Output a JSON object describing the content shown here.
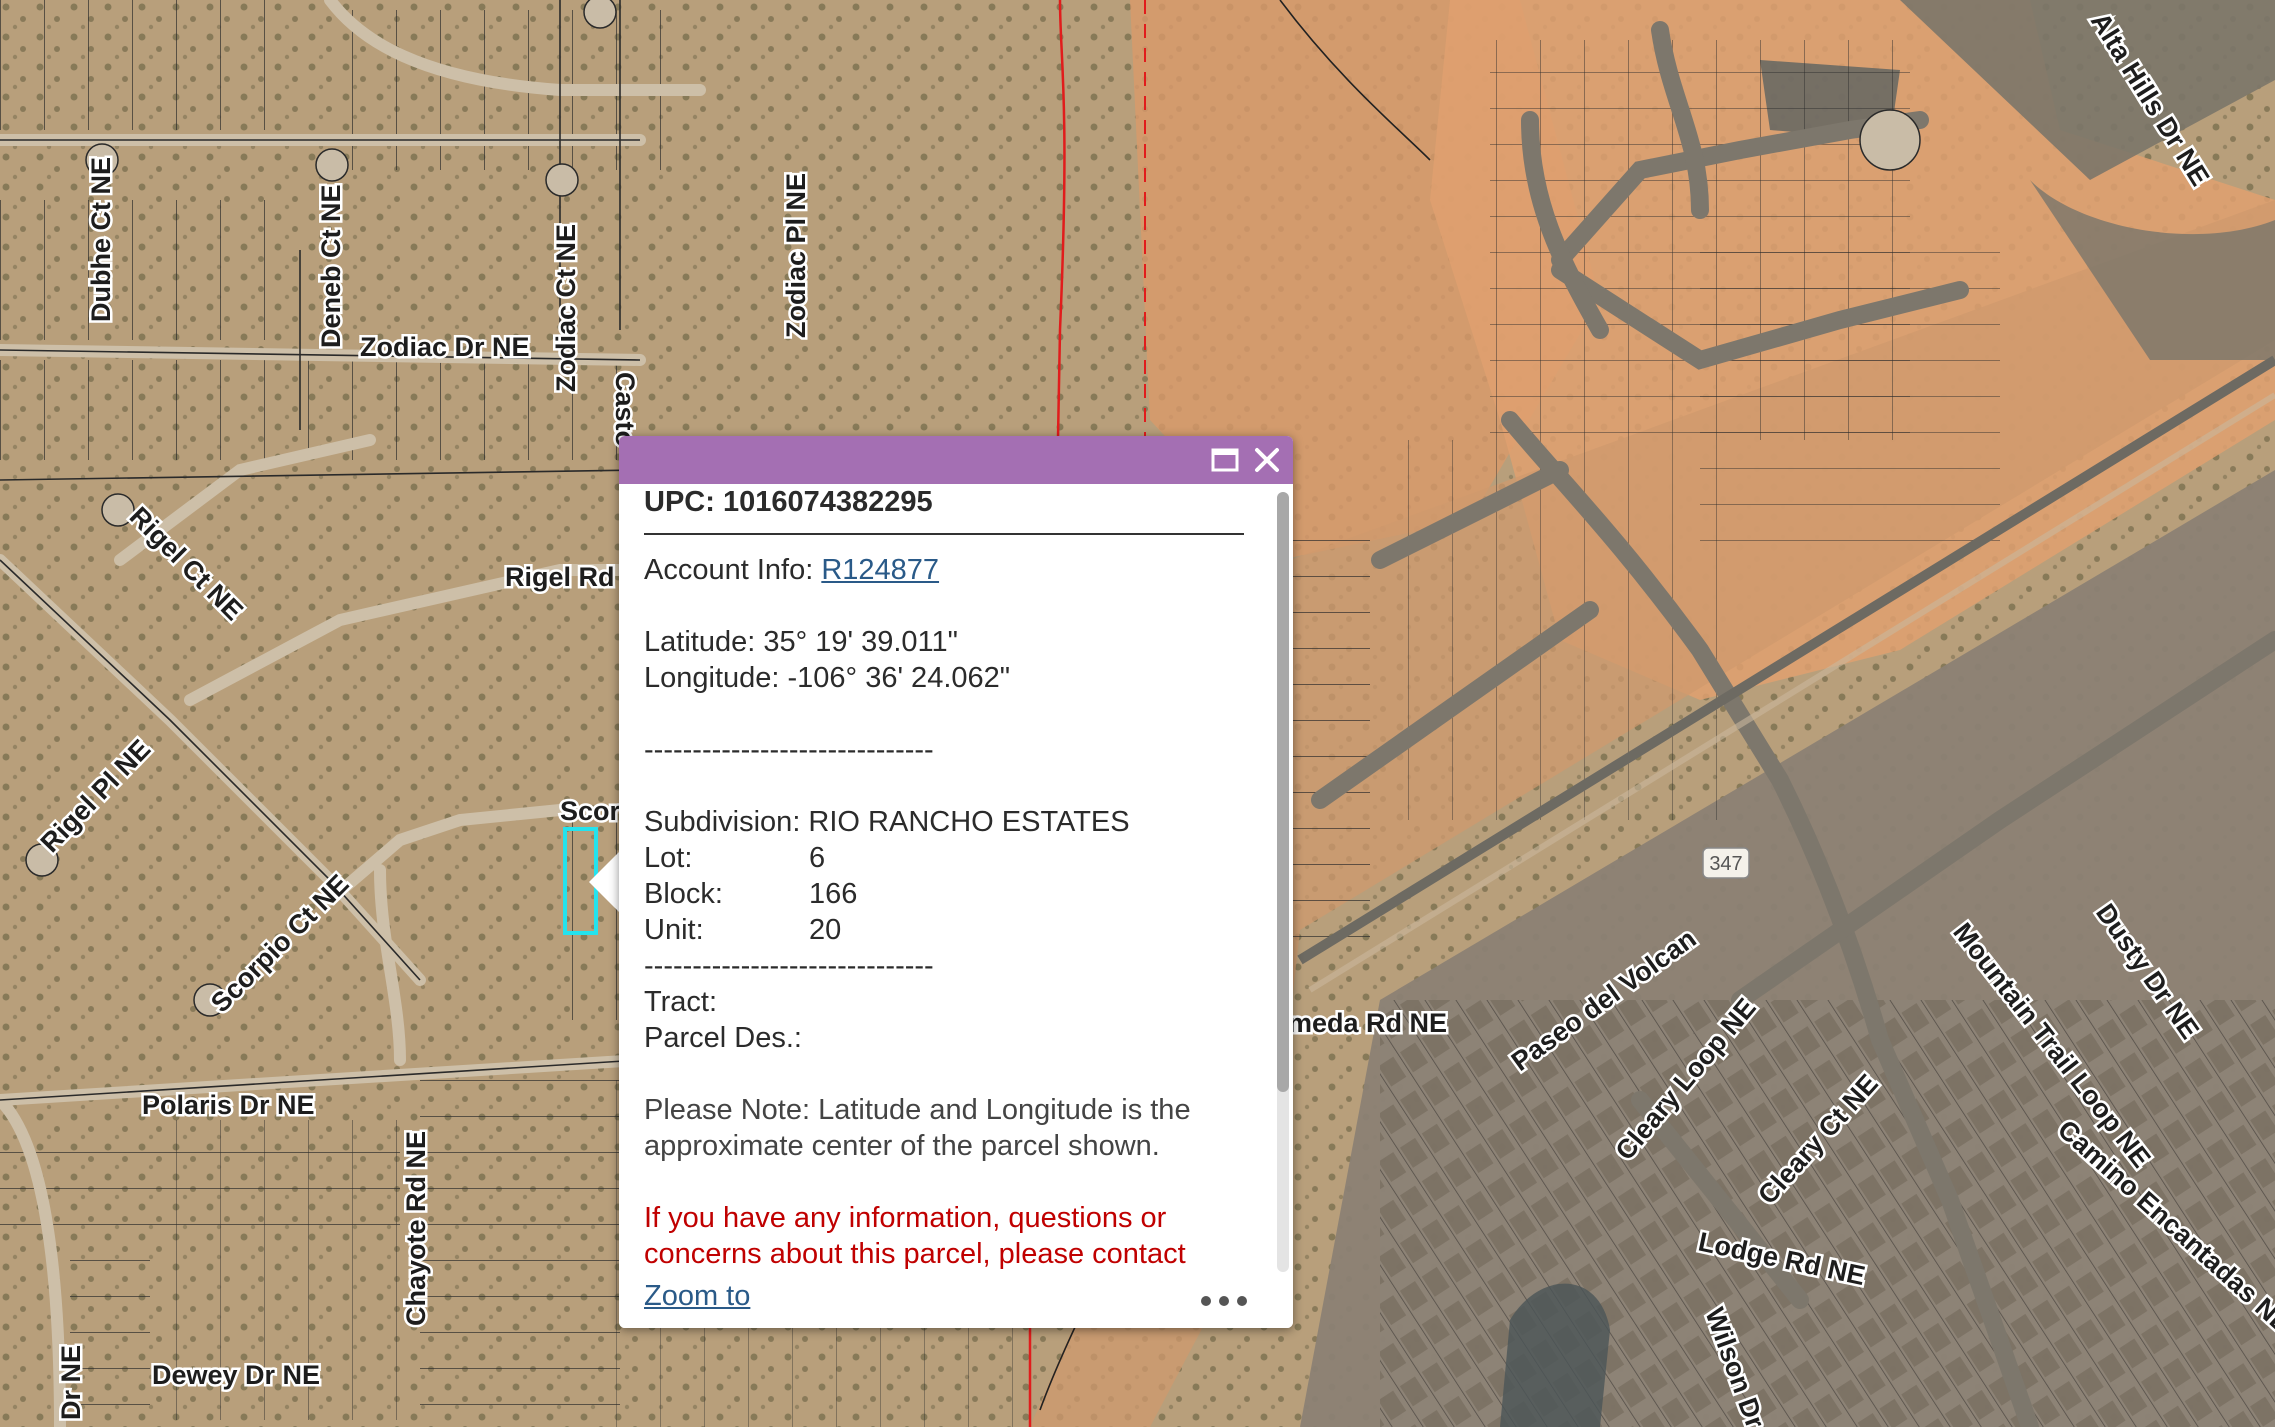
{
  "map": {
    "road_labels": {
      "dubhe": "Dubhe Ct NE",
      "deneb": "Deneb Ct NE",
      "zodiac_dr": "Zodiac Dr NE",
      "zodiac_ct": "Zodiac Ct NE",
      "zodiac_pl": "Zodiac Pl NE",
      "castor": "Casto",
      "rigel_ct": "Rigel Ct NE",
      "rigel_rd": "Rigel Rd",
      "rigel_pl": "Rigel Pl NE",
      "scorpio_top": "Scor",
      "scorpio_ct": "Scorpio Ct NE",
      "polaris": "Polaris Dr NE",
      "chayote": "Chayote Rd NE",
      "dewey": "Dewey Dr NE",
      "dr_ne_left": "Dr NE",
      "paseo": "Paseo del Volcan",
      "meda": "meda Rd NE",
      "cleary_loop": "Cleary Loop NE",
      "cleary_ct": "Cleary Ct NE",
      "lodge": "Lodge Rd NE",
      "wilson": "Wilson Dr NE",
      "mountain_trail": "Mountain Trail Loop NE",
      "dusty": "Dusty Dr NE",
      "camino": "Camino Encantadas NE",
      "alta_hills": "Alta Hills Dr NE",
      "route_347": "347"
    }
  },
  "popup": {
    "title": "UPC: 1016074382295",
    "account_label": "Account Info: ",
    "account_link": "R124877",
    "latitude": "Latitude: 35° 19' 39.011\"",
    "longitude": "Longitude: -106° 36' 24.062\"",
    "separator": "------------------------------",
    "subdivision": "Subdivision: RIO RANCHO ESTATES",
    "lot_label": "Lot:",
    "lot_value": "6",
    "block_label": "Block:",
    "block_value": "166",
    "unit_label": "Unit:",
    "unit_value": "20",
    "tract": "Tract:",
    "parcel_des": "Parcel Des.:",
    "note": "Please Note: Latitude and Longitude is the approximate center of the parcel shown.",
    "warning": "If you have any information, questions or concerns about this parcel, please contact",
    "zoom_link": "Zoom to"
  },
  "colors": {
    "header": "#a46fb3",
    "link": "#2a5a88",
    "warning": "#c00000",
    "selection": "#24e3ee"
  }
}
